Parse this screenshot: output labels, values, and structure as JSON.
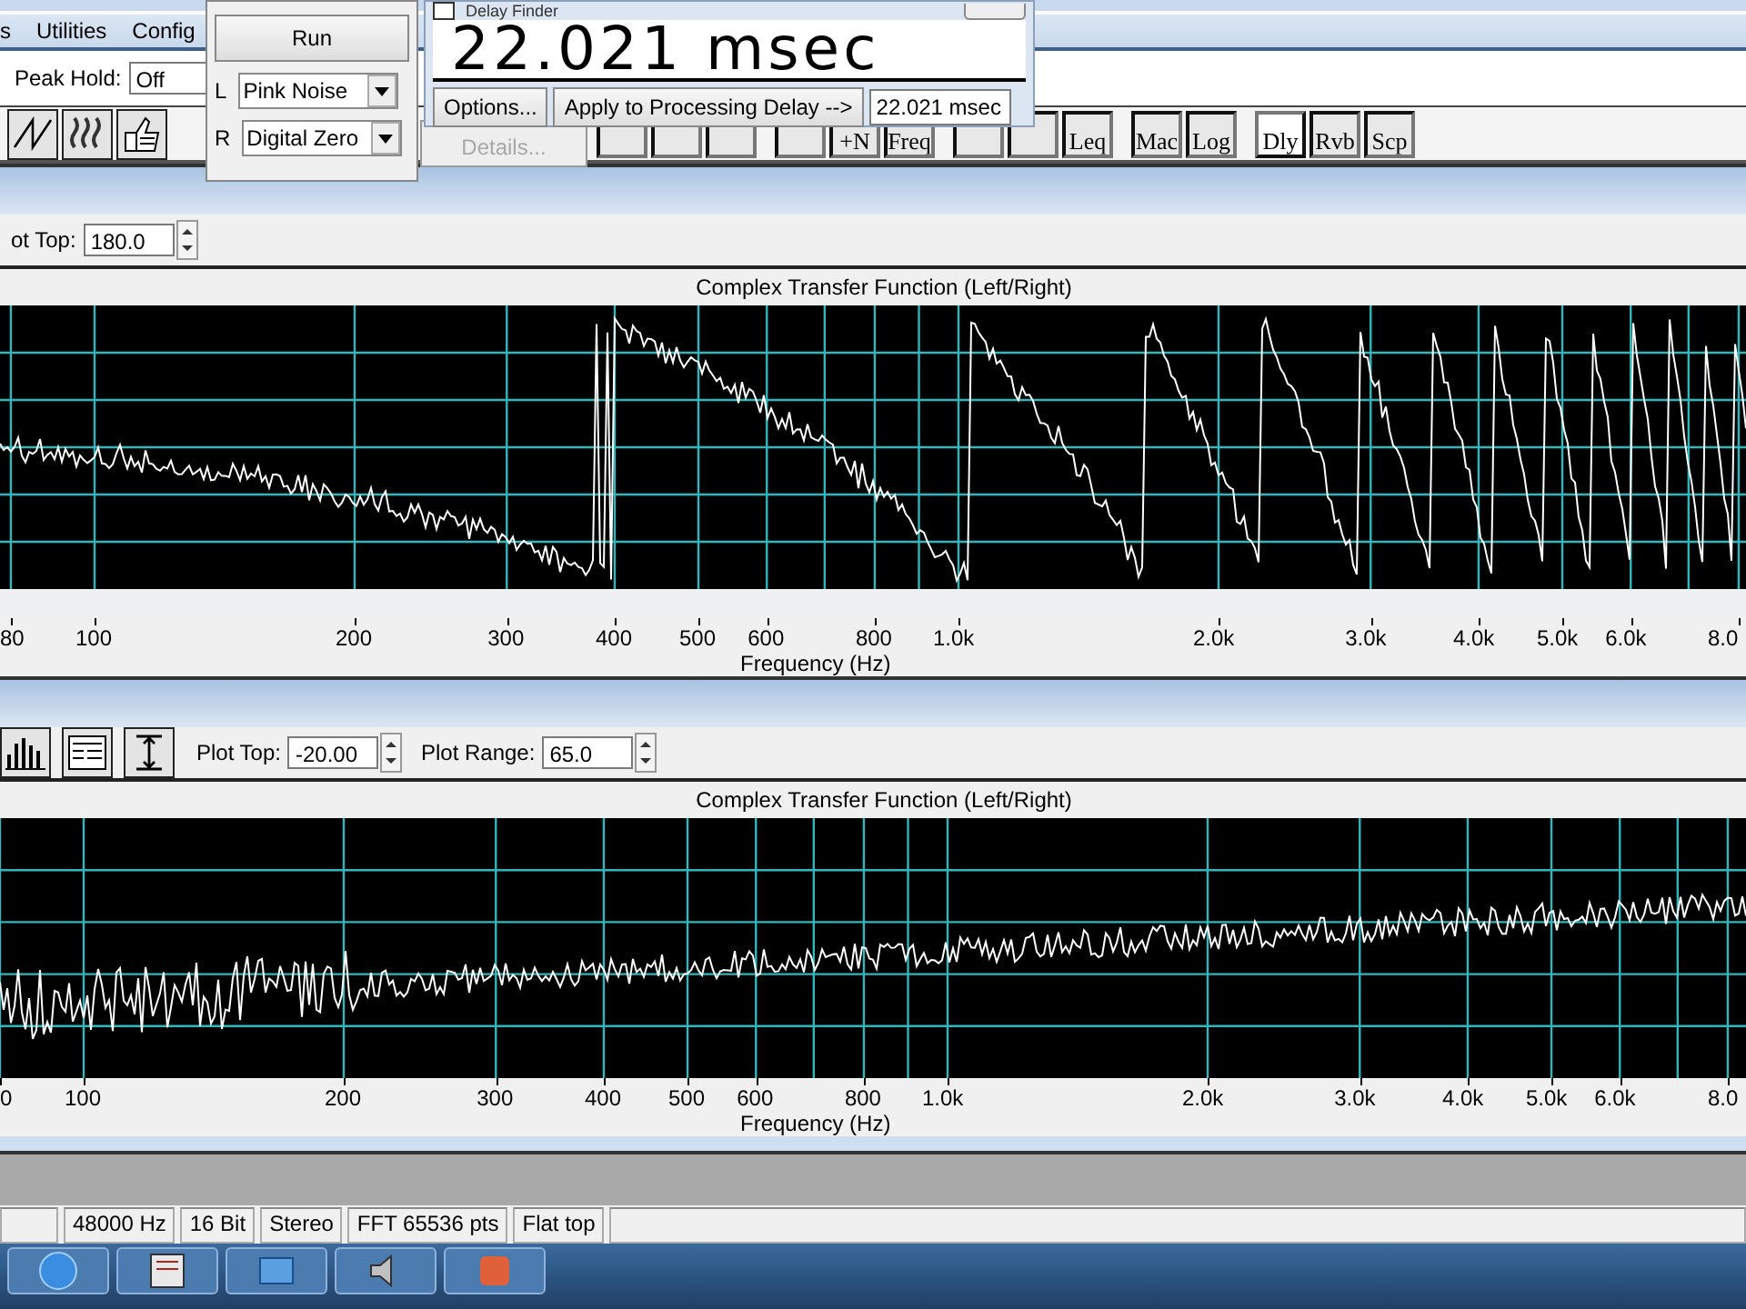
{
  "menu": [
    {
      "label": "s"
    },
    {
      "label": "Utilities"
    },
    {
      "label": "Config"
    }
  ],
  "peak_hold": {
    "label": "Peak Hold:",
    "value": "Off"
  },
  "toolbar_groups": [
    {
      "buttons": [
        {
          "pressed": false
        },
        {
          "pressed": false
        },
        {
          "pressed": false
        }
      ]
    },
    {
      "buttons": [
        {
          "pressed": false
        },
        {
          "label": "+N",
          "pressed": false
        },
        {
          "label": "Freq",
          "pressed": false
        }
      ]
    },
    {
      "buttons": [
        {
          "pressed": false
        },
        {
          "pressed": false
        },
        {
          "label": "Leq",
          "pressed": false
        }
      ]
    },
    {
      "buttons": [
        {
          "label": "Mac",
          "pressed": false
        },
        {
          "label": "Log",
          "pressed": false
        }
      ]
    },
    {
      "buttons": [
        {
          "label": "Dly",
          "pressed": true
        },
        {
          "label": "Rvb",
          "pressed": false
        },
        {
          "label": "Scp",
          "pressed": false
        }
      ]
    }
  ],
  "generator": {
    "button": "Run",
    "channels": [
      {
        "label": "L",
        "value": "Pink Noise"
      },
      {
        "label": "R",
        "value": "Digital Zero"
      }
    ],
    "details": {
      "label": "Details...",
      "disabled": true
    }
  },
  "delay_finder": {
    "title": "Delay Finder",
    "checked": false,
    "reading": "22.021 msec",
    "options": "Options...",
    "apply": "Apply to Processing Delay -->",
    "value": "22.021 msec"
  },
  "plots": [
    {
      "kind": "phase",
      "controls": [
        {
          "label": "ot Top:",
          "value": "180.0"
        }
      ],
      "title": "Complex Transfer Function (Left/Right)",
      "ticks": [
        "80",
        "100",
        "200",
        "300",
        "400",
        "500",
        "600",
        "800",
        "1.0k",
        "2.0k",
        "3.0k",
        "4.0k",
        "5.0k",
        "6.0k",
        "8.0"
      ],
      "xlabel": "Frequency (Hz)"
    },
    {
      "kind": "magnitude",
      "controls": [
        {
          "label": "Plot Top:",
          "value": "-20.00"
        },
        {
          "label": "Plot Range:",
          "value": "65.0"
        }
      ],
      "title": "Complex Transfer Function (Left/Right)",
      "ticks": [
        "0",
        "100",
        "200",
        "300",
        "400",
        "500",
        "600",
        "800",
        "1.0k",
        "2.0k",
        "3.0k",
        "4.0k",
        "5.0k",
        "6.0k",
        "8.0"
      ],
      "xlabel": "Frequency (Hz)"
    }
  ],
  "status_bar": [
    "48000 Hz",
    "16 Bit",
    "Stereo",
    "FFT 65536 pts",
    "Flat top"
  ]
}
